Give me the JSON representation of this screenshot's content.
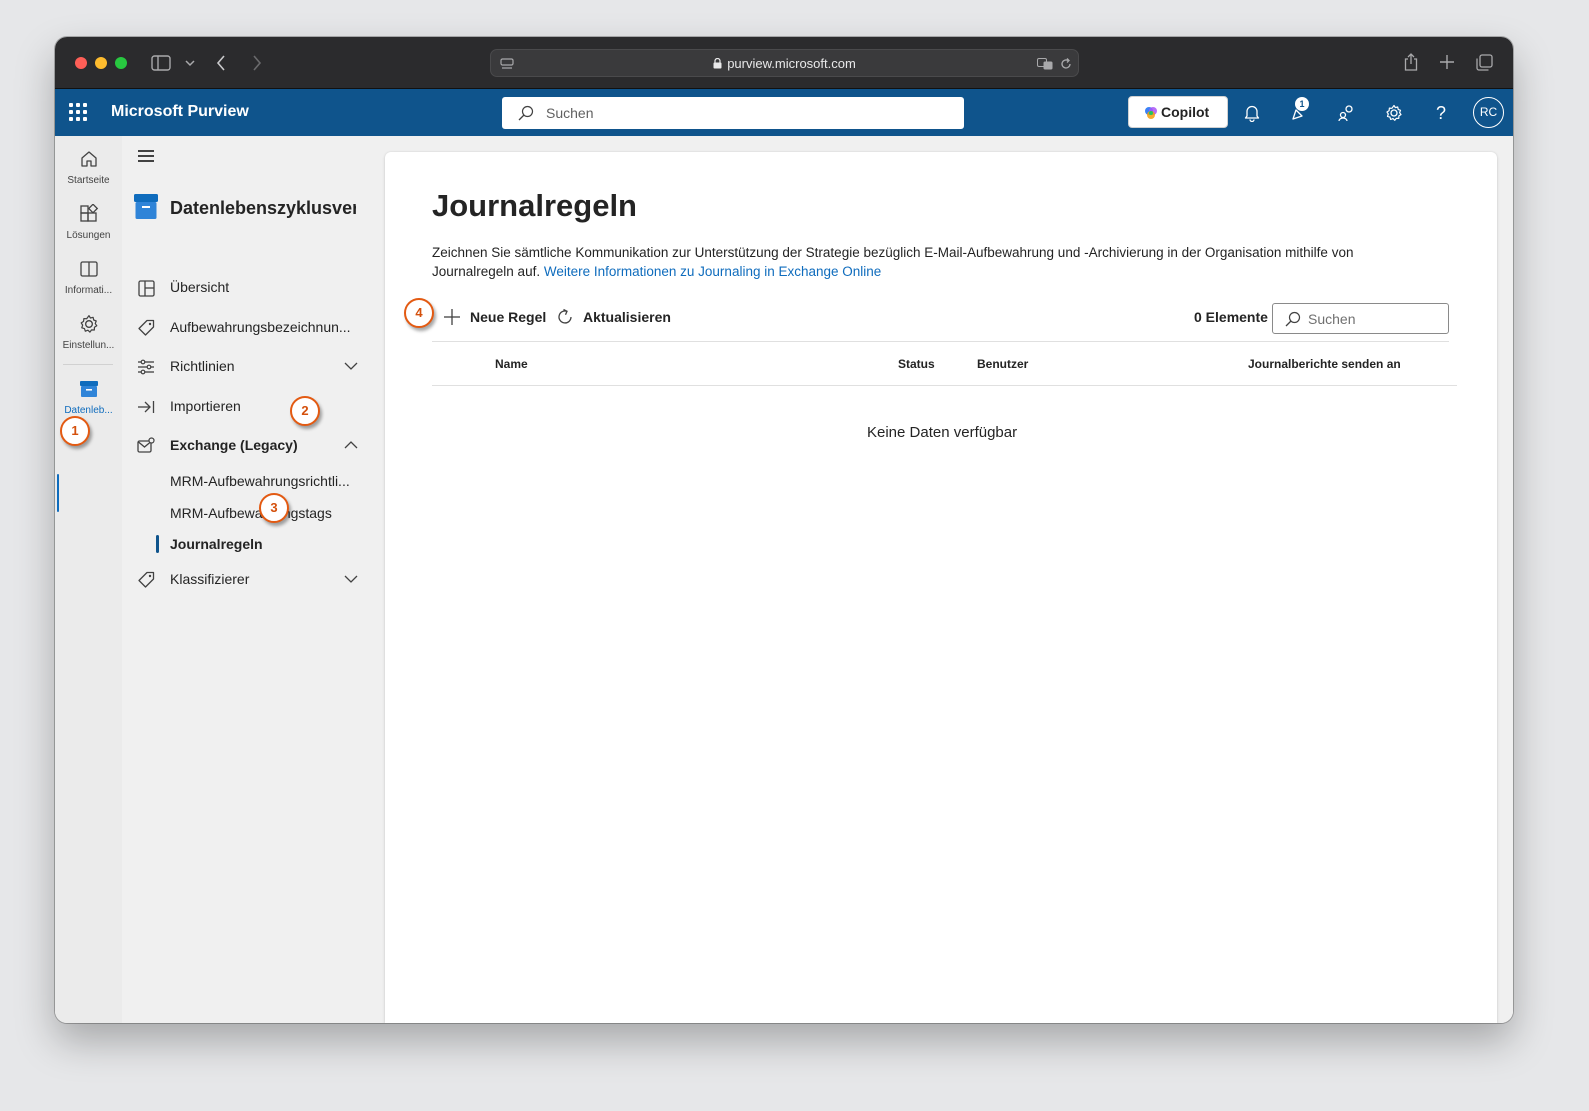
{
  "browser": {
    "url": "purview.microsoft.com"
  },
  "header": {
    "app_title": "Microsoft Purview",
    "search_placeholder": "Suchen",
    "copilot_label": "Copilot",
    "notification_badge": "1",
    "avatar_initials": "RC"
  },
  "rail": {
    "items": [
      {
        "label": "Startseite",
        "icon": "home-icon"
      },
      {
        "label": "Lösungen",
        "icon": "solutions-icon"
      },
      {
        "label": "Informati...",
        "icon": "book-icon"
      },
      {
        "label": "Einstellun...",
        "icon": "gear-icon"
      },
      {
        "label": "Datenleb...",
        "icon": "archive-icon"
      }
    ]
  },
  "nav": {
    "title": "Datenlebenszyklusverw",
    "items": [
      {
        "label": "Übersicht",
        "icon": "overview-icon"
      },
      {
        "label": "Aufbewahrungsbezeichnun...",
        "icon": "tag-icon"
      },
      {
        "label": "Richtlinien",
        "icon": "sliders-icon",
        "expandable": true
      },
      {
        "label": "Importieren",
        "icon": "import-icon"
      },
      {
        "label": "Exchange (Legacy)",
        "icon": "mail-settings-icon",
        "expanded": true
      },
      {
        "label": "Klassifizierer",
        "icon": "tag-icon",
        "expandable": true
      }
    ],
    "sub_items": [
      {
        "label": "MRM-Aufbewahrungsrichtli..."
      },
      {
        "label": "MRM-Aufbewahrungstags"
      },
      {
        "label": "Journalregeln",
        "selected": true
      }
    ]
  },
  "callouts": [
    "1",
    "2",
    "3",
    "4"
  ],
  "main": {
    "title": "Journalregeln",
    "description": "Zeichnen Sie sämtliche Kommunikation zur Unterstützung der Strategie bezüglich E-Mail-Aufbewahrung und -Archivierung in der Organisation mithilfe von Journalregeln auf.",
    "link_text": "Weitere Informationen zu Journaling in Exchange Online",
    "toolbar": {
      "new_rule": "Neue Regel",
      "refresh": "Aktualisieren",
      "count": "0 Elemente",
      "search_placeholder": "Suchen"
    },
    "table": {
      "columns": [
        "Name",
        "Status",
        "Benutzer",
        "Journalberichte senden an"
      ],
      "empty_text": "Keine Daten verfügbar"
    }
  },
  "colors": {
    "suitebar": "#0f548c",
    "link": "#0f6cbd",
    "callout": "#e35a12"
  }
}
